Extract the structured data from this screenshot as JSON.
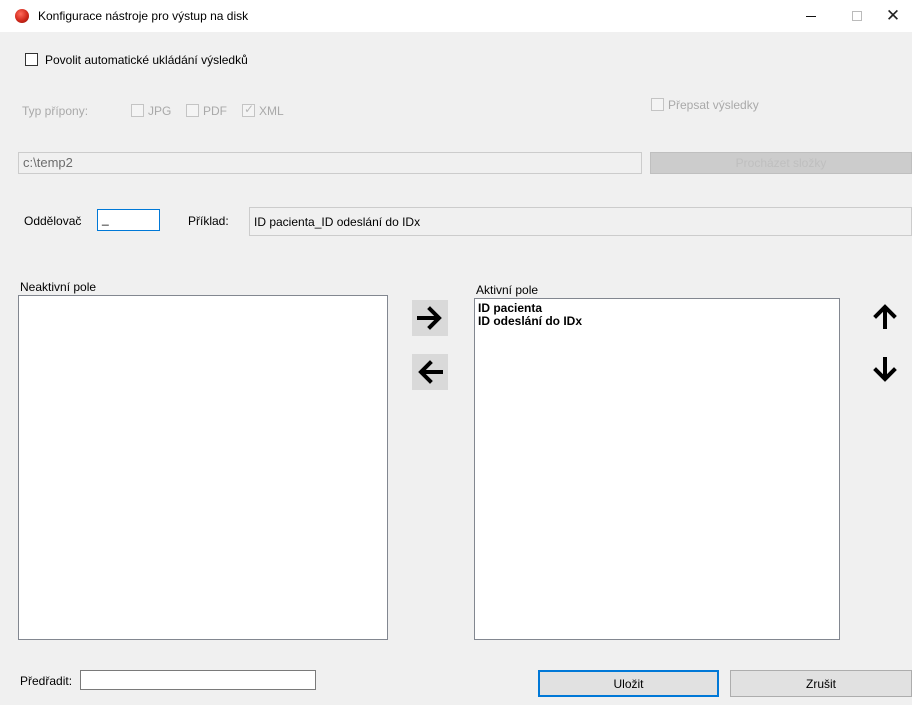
{
  "window": {
    "title": "Konfigurace nástroje pro výstup na disk",
    "controls": {
      "minimize": "minimize-icon",
      "maximize": "maximize-icon",
      "close": "close-icon"
    }
  },
  "autosave": {
    "label": "Povolit automatické ukládání výsledků",
    "checked": false
  },
  "extension": {
    "label": "Typ přípony:",
    "options": [
      {
        "label": "JPG",
        "checked": false
      },
      {
        "label": "PDF",
        "checked": false
      },
      {
        "label": "XML",
        "checked": true
      }
    ]
  },
  "overwrite": {
    "label": "Přepsat výsledky",
    "checked": false
  },
  "path": {
    "value": "c:\\temp2",
    "browse_label": "Procházet složky"
  },
  "separator": {
    "label": "Oddělovač",
    "value": "_",
    "example_label": "Příklad:",
    "example_value": "ID pacienta_ID odeslání do IDx"
  },
  "inactive": {
    "label": "Neaktivní pole",
    "items": []
  },
  "active": {
    "label": "Aktivní pole",
    "items": [
      "ID pacienta",
      "ID odeslání do IDx"
    ]
  },
  "prefix": {
    "label": "Předřadit:",
    "value": ""
  },
  "buttons": {
    "save": "Uložit",
    "cancel": "Zrušit"
  },
  "colors": {
    "accent": "#0078d7",
    "window_bg": "#f0f0f0",
    "arrow_button_bg": "#d9d9d9"
  }
}
